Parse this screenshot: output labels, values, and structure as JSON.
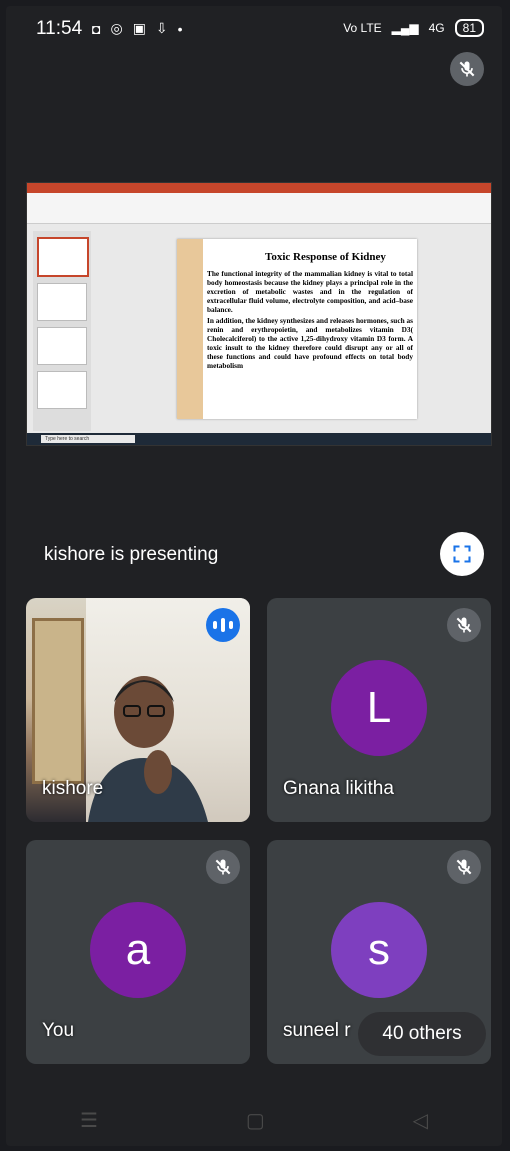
{
  "status_bar": {
    "time": "11:54",
    "network": "Vo LTE",
    "signal": "4G",
    "battery": "81"
  },
  "presentation": {
    "presenter_text": "kishore is presenting",
    "slide_title": "Toxic Response of Kidney",
    "slide_body_1": "The functional integrity of the mammalian kidney is vital to total body homeostasis because the kidney plays a principal role in the excretion of metabolic wastes and in the regulation of extracellular fluid volume, electrolyte composition, and acid–base balance.",
    "slide_body_2": "In addition, the kidney synthesizes and releases hormones, such as renin and erythropoietin, and metabolizes vitamin D3( Cholecalciferol) to the active 1,25-dihydroxy vitamin D3 form. A toxic insult to the kidney therefore could disrupt any or all of these functions and could have profound effects on total body metabolism",
    "search_text": "Type here to search"
  },
  "participants": [
    {
      "name": "kishore",
      "initial": "",
      "type": "video",
      "muted": false,
      "speaking": true
    },
    {
      "name": "Gnana likitha",
      "initial": "L",
      "type": "avatar",
      "muted": true,
      "color": "#7b1fa2"
    },
    {
      "name": "You",
      "initial": "a",
      "type": "avatar",
      "muted": true,
      "color": "#7b1fa2"
    },
    {
      "name": "suneel r",
      "initial": "s",
      "type": "avatar",
      "muted": true,
      "color": "#7e3fbf"
    }
  ],
  "others_label": "40 others",
  "icons": {
    "mute": "mic-off-icon",
    "fullscreen": "fullscreen-icon",
    "speaking": "audio-level-icon"
  }
}
